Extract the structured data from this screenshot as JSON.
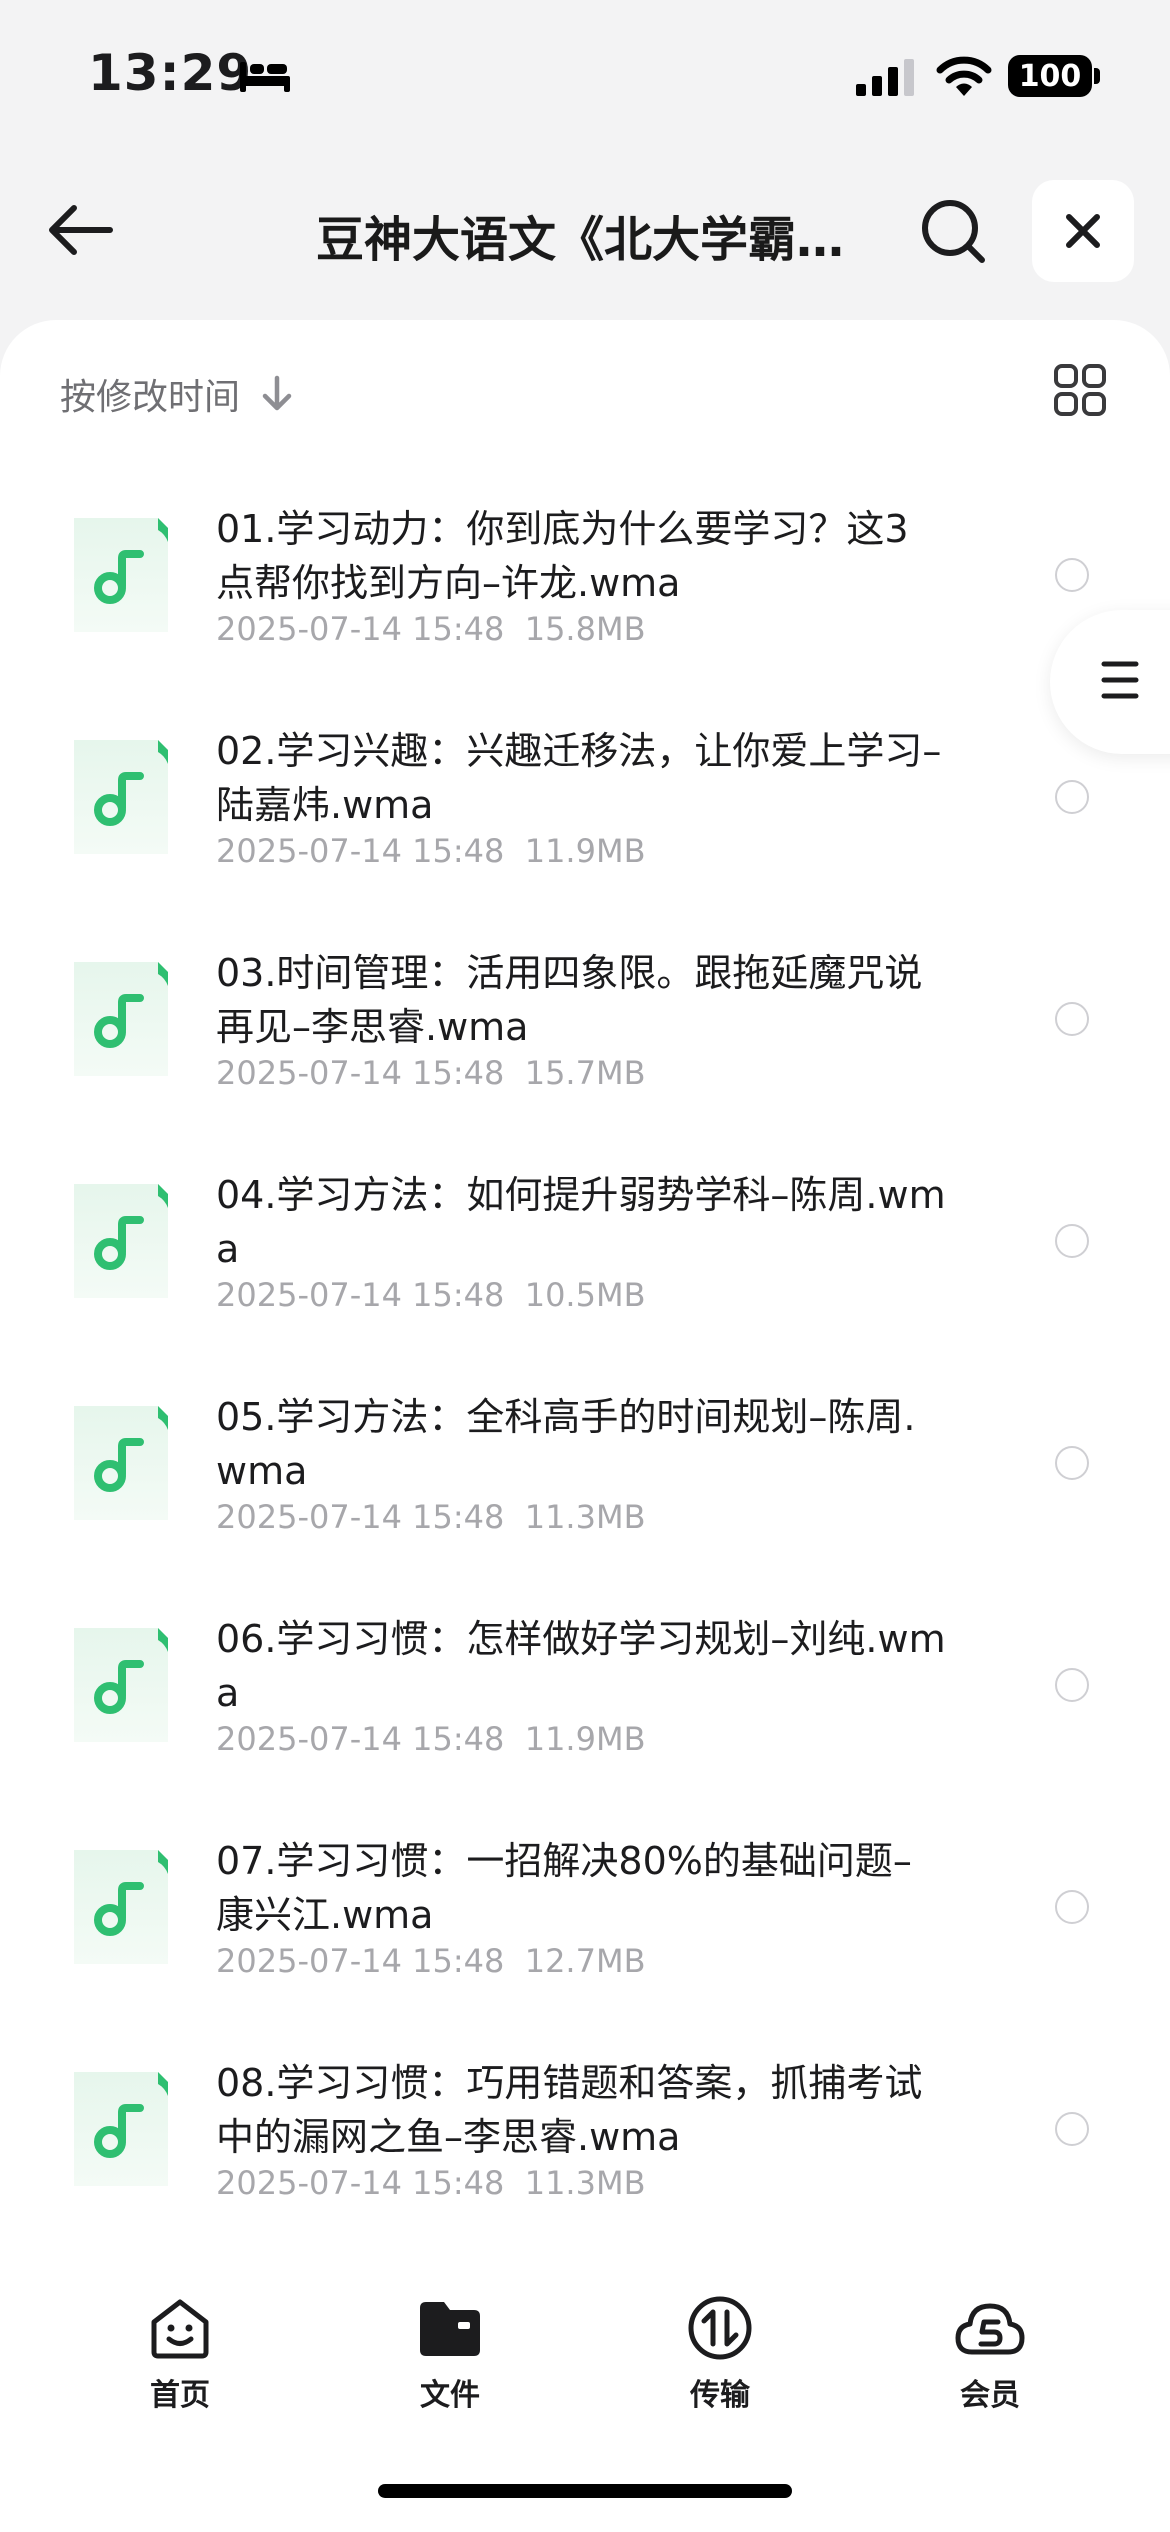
{
  "status_bar": {
    "time": "13:29",
    "battery": "100"
  },
  "nav": {
    "title": "豆神大语文《北大学霸…"
  },
  "sort": {
    "label": "按修改时间"
  },
  "files": [
    {
      "name": "01.学习动力：你到底为什么要学习？这3点帮你找到方向–许龙.wma",
      "meta": "2025-07-14 15:48  15.8MB"
    },
    {
      "name": "02.学习兴趣：兴趣迁移法，让你爱上学习–陆嘉炜.wma",
      "meta": "2025-07-14 15:48  11.9MB"
    },
    {
      "name": "03.时间管理：活用四象限。跟拖延魔咒说再见–李思睿.wma",
      "meta": "2025-07-14 15:48  15.7MB"
    },
    {
      "name": "04.学习方法：如何提升弱势学科–陈周.wma",
      "meta": "2025-07-14 15:48  10.5MB"
    },
    {
      "name": "05.学习方法：全科高手的时间规划–陈周.wma",
      "meta": "2025-07-14 15:48  11.3MB"
    },
    {
      "name": "06.学习习惯：怎样做好学习规划–刘纯.wma",
      "meta": "2025-07-14 15:48  11.9MB"
    },
    {
      "name": "07.学习习惯：一招解决80%的基础问题–康兴江.wma",
      "meta": "2025-07-14 15:48  12.7MB"
    },
    {
      "name": "08.学习习惯：巧用错题和答案，抓捕考试中的漏网之鱼–李思睿.wma",
      "meta": "2025-07-14 15:48  11.3MB"
    }
  ],
  "tabs": [
    {
      "label": "首页",
      "icon": "home-smile-icon"
    },
    {
      "label": "文件",
      "icon": "folder-icon"
    },
    {
      "label": "传输",
      "icon": "transfer-icon"
    },
    {
      "label": "会员",
      "icon": "cloud-vip-icon"
    }
  ],
  "colors": {
    "accent_green": "#2fbf71",
    "background": "#f3f3f4"
  }
}
